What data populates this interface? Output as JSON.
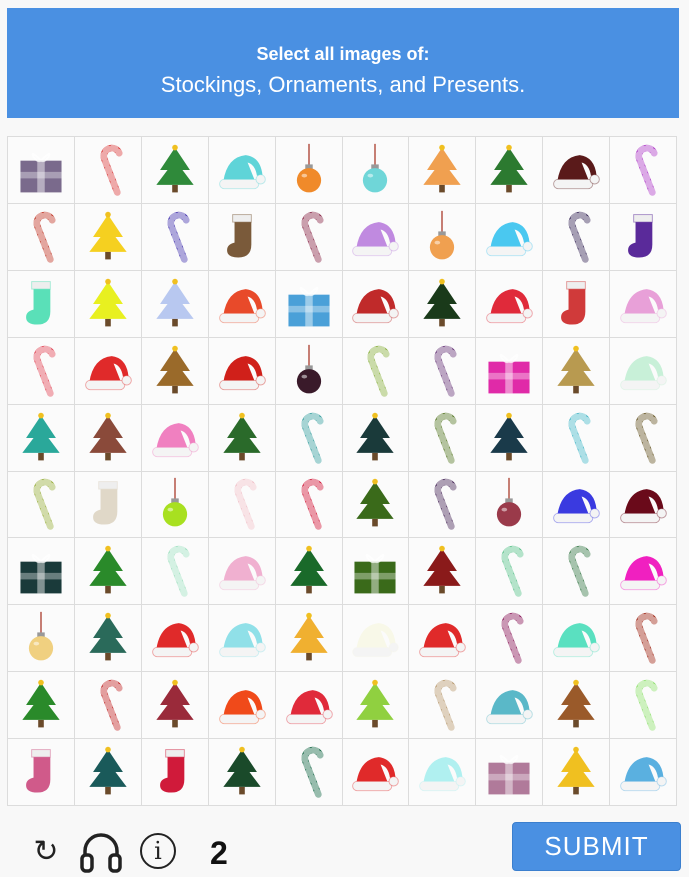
{
  "header": {
    "instruction": "Select all images of:",
    "target": "Stockings, Ornaments, and Presents."
  },
  "grid": {
    "rows": [
      [
        {
          "type": "present",
          "color": "#7a6a8c"
        },
        {
          "type": "cane",
          "color": "#d94040"
        },
        {
          "type": "tree",
          "color": "#2f8a3a"
        },
        {
          "type": "hat",
          "color": "#5fd4d8"
        },
        {
          "type": "ornament",
          "color": "#f08a2a"
        },
        {
          "type": "ornament",
          "color": "#6fd6d8"
        },
        {
          "type": "tree",
          "color": "#f0a050"
        },
        {
          "type": "tree",
          "color": "#2c7a30"
        },
        {
          "type": "hat",
          "color": "#5a1a1a"
        },
        {
          "type": "cane",
          "color": "#b040c8"
        }
      ],
      [
        {
          "type": "cane",
          "color": "#c03a2a"
        },
        {
          "type": "tree",
          "color": "#f5d020"
        },
        {
          "type": "cane",
          "color": "#4a3ab0"
        },
        {
          "type": "stocking",
          "color": "#7a5a3a"
        },
        {
          "type": "cane",
          "color": "#8a2a4a"
        },
        {
          "type": "hat",
          "color": "#c08ae0"
        },
        {
          "type": "ornament",
          "color": "#f0a050"
        },
        {
          "type": "hat",
          "color": "#4ac8f0"
        },
        {
          "type": "cane",
          "color": "#3a2a5a"
        },
        {
          "type": "stocking",
          "color": "#5a2a9a"
        }
      ],
      [
        {
          "type": "stocking",
          "color": "#5ae0b8"
        },
        {
          "type": "tree",
          "color": "#e8f020"
        },
        {
          "type": "tree",
          "color": "#b8c8f0"
        },
        {
          "type": "hat",
          "color": "#e84a2a"
        },
        {
          "type": "present",
          "color": "#4aa0d8"
        },
        {
          "type": "hat",
          "color": "#c02a2a"
        },
        {
          "type": "tree",
          "color": "#1a3a1a"
        },
        {
          "type": "hat",
          "color": "#e02a3a"
        },
        {
          "type": "stocking",
          "color": "#d03a3a"
        },
        {
          "type": "hat",
          "color": "#e8a0d8"
        }
      ],
      [
        {
          "type": "cane",
          "color": "#e04a5a"
        },
        {
          "type": "hat",
          "color": "#e02a2a"
        },
        {
          "type": "tree",
          "color": "#9a6a2a"
        },
        {
          "type": "hat",
          "color": "#d0201a"
        },
        {
          "type": "ornament",
          "color": "#3a1a2a"
        },
        {
          "type": "cane",
          "color": "#8ab040"
        },
        {
          "type": "cane",
          "color": "#6a3a7a"
        },
        {
          "type": "present",
          "color": "#e02aa8"
        },
        {
          "type": "tree",
          "color": "#b89a50"
        },
        {
          "type": "hat",
          "color": "#c8f0d8"
        }
      ],
      [
        {
          "type": "tree",
          "color": "#2aa89a"
        },
        {
          "type": "tree",
          "color": "#8a4a3a"
        },
        {
          "type": "hat",
          "color": "#f080c0"
        },
        {
          "type": "tree",
          "color": "#2a6a2a"
        },
        {
          "type": "cane",
          "color": "#3aa0a0"
        },
        {
          "type": "tree",
          "color": "#1a3a3a"
        },
        {
          "type": "cane",
          "color": "#5a7a2a"
        },
        {
          "type": "tree",
          "color": "#1a3a4a"
        },
        {
          "type": "cane",
          "color": "#4ab8c8"
        },
        {
          "type": "cane",
          "color": "#6a5a2a"
        }
      ],
      [
        {
          "type": "cane",
          "color": "#9ab040"
        },
        {
          "type": "stocking",
          "color": "#e0d8c8"
        },
        {
          "type": "ornament",
          "color": "#a8e020"
        },
        {
          "type": "cane",
          "color": "#f0c0c8"
        },
        {
          "type": "cane",
          "color": "#d01a3a"
        },
        {
          "type": "tree",
          "color": "#3a6a1a"
        },
        {
          "type": "cane",
          "color": "#4a2a5a"
        },
        {
          "type": "ornament",
          "color": "#9a3a4a"
        },
        {
          "type": "hat",
          "color": "#3a3ae0"
        },
        {
          "type": "hat",
          "color": "#6a0a1a"
        }
      ],
      [
        {
          "type": "present",
          "color": "#1a3a3a"
        },
        {
          "type": "tree",
          "color": "#2a8a2a"
        },
        {
          "type": "cane",
          "color": "#a0e0c0"
        },
        {
          "type": "hat",
          "color": "#f0b0d0"
        },
        {
          "type": "tree",
          "color": "#1a6a2a"
        },
        {
          "type": "present",
          "color": "#3a6a1a"
        },
        {
          "type": "tree",
          "color": "#8a1a1a"
        },
        {
          "type": "cane",
          "color": "#5ac08a"
        },
        {
          "type": "cane",
          "color": "#3a7a4a"
        },
        {
          "type": "hat",
          "color": "#f020c0"
        }
      ],
      [
        {
          "type": "ornament",
          "color": "#f0d080"
        },
        {
          "type": "tree",
          "color": "#2a6a5a"
        },
        {
          "type": "hat",
          "color": "#e02a2a"
        },
        {
          "type": "hat",
          "color": "#90e0e8"
        },
        {
          "type": "tree",
          "color": "#f0b030"
        },
        {
          "type": "hat",
          "color": "#f8f8e8"
        },
        {
          "type": "hat",
          "color": "#e02a2a"
        },
        {
          "type": "cane",
          "color": "#8a1a5a"
        },
        {
          "type": "hat",
          "color": "#5ae0c0"
        },
        {
          "type": "cane",
          "color": "#a02a1a"
        }
      ],
      [
        {
          "type": "tree",
          "color": "#2a8a2a"
        },
        {
          "type": "cane",
          "color": "#c02a2a"
        },
        {
          "type": "tree",
          "color": "#9a2a3a"
        },
        {
          "type": "hat",
          "color": "#f04a1a"
        },
        {
          "type": "hat",
          "color": "#e02a3a"
        },
        {
          "type": "tree",
          "color": "#90d040"
        },
        {
          "type": "cane",
          "color": "#b89a70"
        },
        {
          "type": "hat",
          "color": "#5ab8c8"
        },
        {
          "type": "tree",
          "color": "#9a5a2a"
        },
        {
          "type": "cane",
          "color": "#90e070"
        }
      ],
      [
        {
          "type": "stocking",
          "color": "#d05a8a"
        },
        {
          "type": "tree",
          "color": "#1a5a5a"
        },
        {
          "type": "stocking",
          "color": "#d01a3a"
        },
        {
          "type": "tree",
          "color": "#1a4a2a"
        },
        {
          "type": "cane",
          "color": "#1a6a4a"
        },
        {
          "type": "hat",
          "color": "#e02a2a"
        },
        {
          "type": "hat",
          "color": "#b0f0f0"
        },
        {
          "type": "present",
          "color": "#b07a9a"
        },
        {
          "type": "tree",
          "color": "#f0c020"
        },
        {
          "type": "hat",
          "color": "#5ab0e0"
        }
      ]
    ]
  },
  "footer": {
    "reload_icon": "reload-icon",
    "audio_icon": "headphones-icon",
    "info_icon": "info-icon",
    "selected_count": "2",
    "submit_label": "SUBMIT"
  },
  "colors": {
    "accent": "#4a90e2"
  }
}
